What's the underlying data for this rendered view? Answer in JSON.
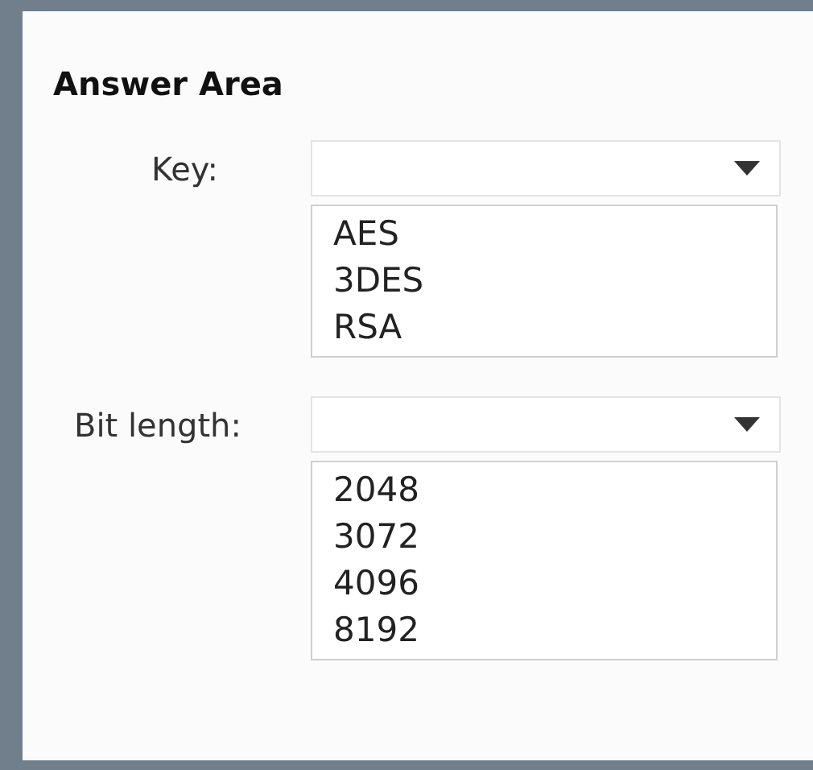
{
  "title": "Answer Area",
  "fields": [
    {
      "label": "Key:",
      "options": [
        "AES",
        "3DES",
        "RSA"
      ]
    },
    {
      "label": "Bit length:",
      "options": [
        "2048",
        "3072",
        "4096",
        "8192"
      ]
    }
  ]
}
